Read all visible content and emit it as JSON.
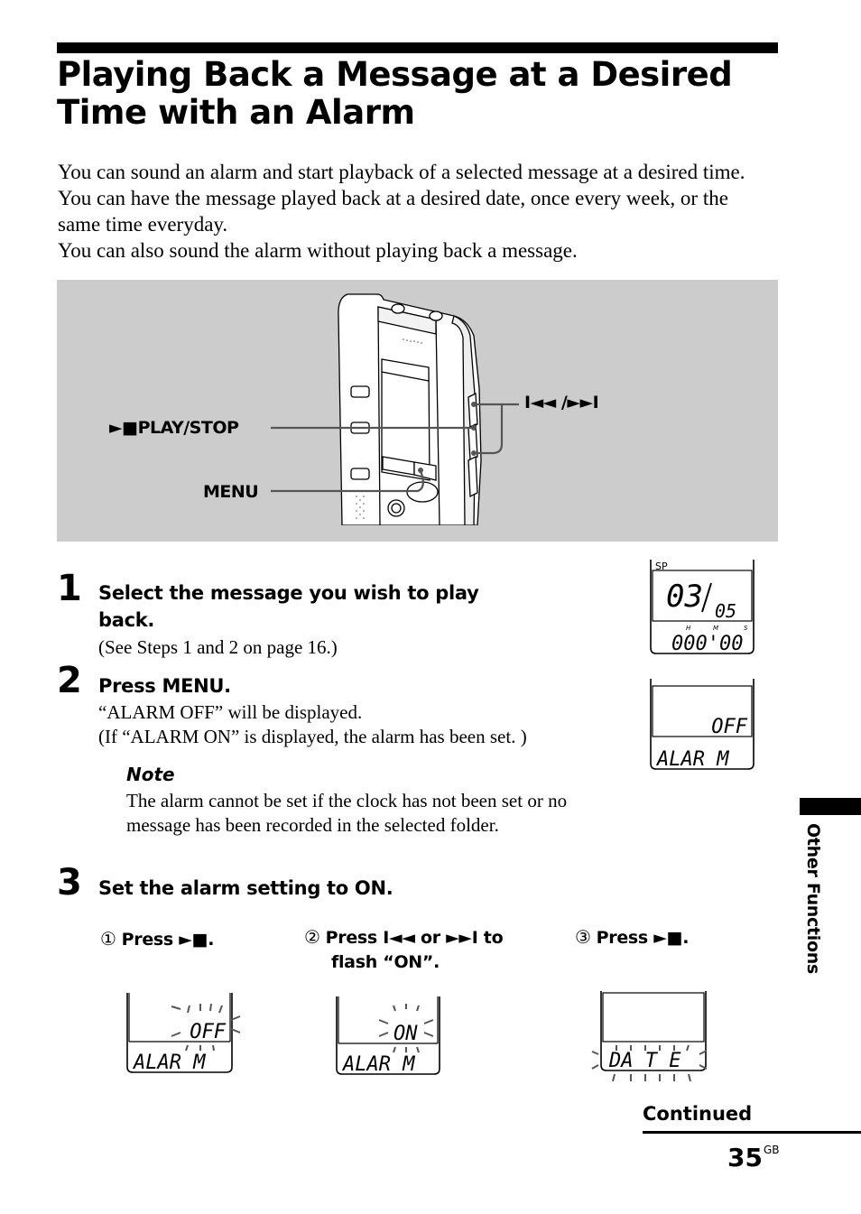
{
  "header": {
    "title_line1": "Playing Back a Message at a Desired",
    "title_line2": "Time with an Alarm"
  },
  "intro": {
    "paragraph1": "You can sound an alarm and start playback of a selected message at a desired time. You can have the message played back at a desired date, once every week, or the same time everyday.",
    "paragraph2": "You can also sound the alarm without playing back a message."
  },
  "illustration": {
    "callouts": {
      "play_stop": "►■PLAY/STOP",
      "menu": "MENU",
      "skip": "I◄◄ /►►I"
    }
  },
  "steps": [
    {
      "number": "1",
      "heading_line1": "Select the message you wish to play",
      "heading_line2": "back.",
      "body": "(See Steps 1 and 2 on page 16.)"
    },
    {
      "number": "2",
      "heading": "Press MENU.",
      "body_line1": "“ALARM OFF” will be displayed.",
      "body_line2": "(If “ALARM ON” is displayed, the alarm has been set. )",
      "note": {
        "title": "Note",
        "text": "The alarm cannot be set if the clock has not been set or no message has been recorded in the selected folder."
      }
    },
    {
      "number": "3",
      "heading": "Set the alarm setting to ON.",
      "substeps": [
        {
          "marker": "①",
          "text": "Press ►■."
        },
        {
          "marker": "②",
          "text_line1": "Press I◄◄ or ►►I to",
          "text_line2": "flash “ON”."
        },
        {
          "marker": "③",
          "text": "Press ►■."
        }
      ]
    }
  ],
  "displays": {
    "step1": {
      "mode": "SP",
      "message": "03",
      "total": "05",
      "time": "000'00",
      "units": [
        "H",
        "M",
        "S"
      ]
    },
    "step2": {
      "value": "OFF",
      "label": "ALAR M"
    },
    "sub1": {
      "value": "OFF",
      "label": "ALAR M",
      "flashing": "value"
    },
    "sub2": {
      "value": "ON",
      "label": "ALAR M",
      "flashing": "value"
    },
    "sub3": {
      "value": "",
      "label": "DA T E",
      "flashing": "label"
    }
  },
  "sidebar": {
    "section": "Other Functions"
  },
  "footer": {
    "continued": "Continued",
    "page_number": "35",
    "page_suffix": "GB"
  }
}
